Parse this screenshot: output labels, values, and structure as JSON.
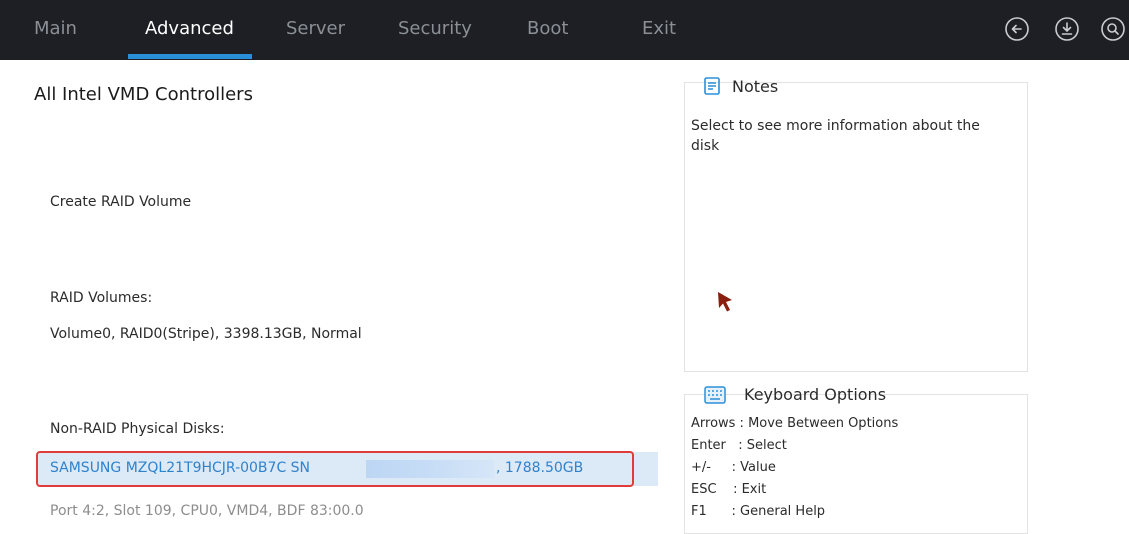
{
  "tabs": [
    {
      "label": "Main"
    },
    {
      "label": "Advanced"
    },
    {
      "label": "Server"
    },
    {
      "label": "Security"
    },
    {
      "label": "Boot"
    },
    {
      "label": "Exit"
    }
  ],
  "active_tab": "Advanced",
  "top_icons": [
    "back-icon",
    "save-icon",
    "search-icon"
  ],
  "main": {
    "title": "All Intel VMD Controllers",
    "create_raid": "Create RAID Volume",
    "raid_volumes_label": "RAID Volumes:",
    "volume0": "Volume0, RAID0(Stripe), 3398.13GB, Normal",
    "non_raid_label": "Non-RAID Physical Disks:",
    "disk_name": "SAMSUNG MZQL21T9HCJR-00B7C SN",
    "disk_size": ", 1788.50GB",
    "port_info": "Port 4:2, Slot 109, CPU0, VMD4, BDF 83:00.0"
  },
  "notes": {
    "title": "Notes",
    "text": "Select to see more information about the disk"
  },
  "keyboard": {
    "title": "Keyboard Options",
    "lines": [
      "Arrows : Move Between Options",
      "Enter   : Select",
      "+/-     : Value",
      "ESC    : Exit",
      "F1      : General Help"
    ]
  },
  "colors": {
    "topbar": "#1d1f24",
    "accent": "#2a8fd9",
    "selected_row": "#dce9f7",
    "selected_text": "#2f82cc",
    "highlight_outline": "#e23b3b"
  }
}
